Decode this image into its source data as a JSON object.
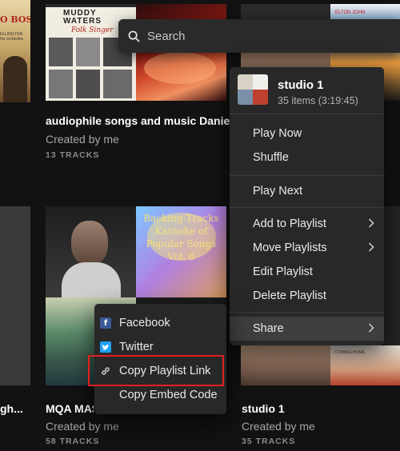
{
  "search": {
    "placeholder": "Search",
    "icon": "search-icon"
  },
  "tiles": [
    {
      "title": "audiophile songs and music Daniel",
      "subtitle": "Created by me",
      "count": "13 TRACKS",
      "cover_text": [
        "MUDDY",
        "WATERS",
        "Folk Singer"
      ]
    },
    {
      "title": "MQA MASTER",
      "subtitle": "Created by me",
      "count": "58 TRACKS",
      "cover_text": [
        "Backing Tracks",
        "Karaoke of",
        "Popular Songs",
        "Vol. 6"
      ]
    },
    {
      "title": "studio 1",
      "subtitle": "Created by me",
      "count": "35 TRACKS"
    },
    {
      "title": "gh...",
      "cover_text": [
        "O BOSSA",
        "ELLINGTON",
        "his orchestra"
      ]
    }
  ],
  "context_menu": {
    "playlist_title": "studio 1",
    "playlist_meta": "35 items (3:19:45)",
    "items": [
      {
        "label": "Play Now"
      },
      {
        "label": "Shuffle"
      },
      {
        "label": "Play Next"
      },
      {
        "label": "Add to Playlist",
        "submenu": true
      },
      {
        "label": "Move Playlists",
        "submenu": true
      },
      {
        "label": "Edit Playlist"
      },
      {
        "label": "Delete Playlist"
      },
      {
        "label": "Share",
        "submenu": true,
        "active": true
      }
    ]
  },
  "share_menu": {
    "items": [
      {
        "label": "Facebook",
        "icon": "facebook-icon"
      },
      {
        "label": "Twitter",
        "icon": "twitter-icon"
      },
      {
        "label": "Copy Playlist Link",
        "icon": "link-icon",
        "highlighted": true
      },
      {
        "label": "Copy Embed Code"
      }
    ]
  },
  "colors": {
    "background": "#121212",
    "menu_background": "#282828",
    "menu_active": "#3e3e3e",
    "highlight_border": "#e02020",
    "facebook": "#3b5998",
    "twitter": "#1da1f2"
  }
}
